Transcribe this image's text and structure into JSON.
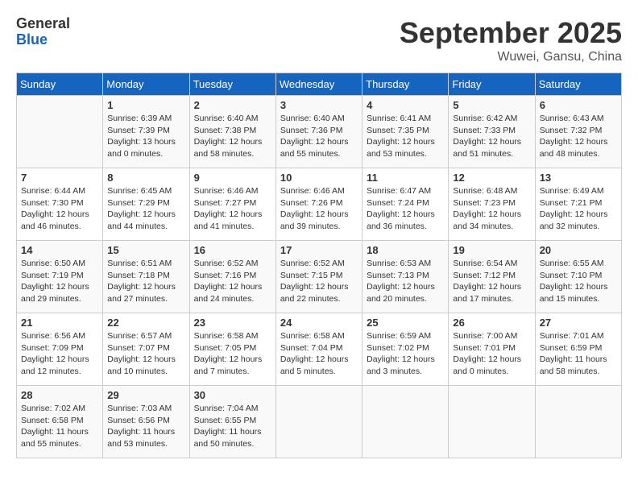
{
  "header": {
    "logo_general": "General",
    "logo_blue": "Blue",
    "month_title": "September 2025",
    "subtitle": "Wuwei, Gansu, China"
  },
  "days_of_week": [
    "Sunday",
    "Monday",
    "Tuesday",
    "Wednesday",
    "Thursday",
    "Friday",
    "Saturday"
  ],
  "weeks": [
    {
      "days": [
        {
          "number": "",
          "info": ""
        },
        {
          "number": "1",
          "info": "Sunrise: 6:39 AM\nSunset: 7:39 PM\nDaylight: 13 hours\nand 0 minutes."
        },
        {
          "number": "2",
          "info": "Sunrise: 6:40 AM\nSunset: 7:38 PM\nDaylight: 12 hours\nand 58 minutes."
        },
        {
          "number": "3",
          "info": "Sunrise: 6:40 AM\nSunset: 7:36 PM\nDaylight: 12 hours\nand 55 minutes."
        },
        {
          "number": "4",
          "info": "Sunrise: 6:41 AM\nSunset: 7:35 PM\nDaylight: 12 hours\nand 53 minutes."
        },
        {
          "number": "5",
          "info": "Sunrise: 6:42 AM\nSunset: 7:33 PM\nDaylight: 12 hours\nand 51 minutes."
        },
        {
          "number": "6",
          "info": "Sunrise: 6:43 AM\nSunset: 7:32 PM\nDaylight: 12 hours\nand 48 minutes."
        }
      ]
    },
    {
      "days": [
        {
          "number": "7",
          "info": "Sunrise: 6:44 AM\nSunset: 7:30 PM\nDaylight: 12 hours\nand 46 minutes."
        },
        {
          "number": "8",
          "info": "Sunrise: 6:45 AM\nSunset: 7:29 PM\nDaylight: 12 hours\nand 44 minutes."
        },
        {
          "number": "9",
          "info": "Sunrise: 6:46 AM\nSunset: 7:27 PM\nDaylight: 12 hours\nand 41 minutes."
        },
        {
          "number": "10",
          "info": "Sunrise: 6:46 AM\nSunset: 7:26 PM\nDaylight: 12 hours\nand 39 minutes."
        },
        {
          "number": "11",
          "info": "Sunrise: 6:47 AM\nSunset: 7:24 PM\nDaylight: 12 hours\nand 36 minutes."
        },
        {
          "number": "12",
          "info": "Sunrise: 6:48 AM\nSunset: 7:23 PM\nDaylight: 12 hours\nand 34 minutes."
        },
        {
          "number": "13",
          "info": "Sunrise: 6:49 AM\nSunset: 7:21 PM\nDaylight: 12 hours\nand 32 minutes."
        }
      ]
    },
    {
      "days": [
        {
          "number": "14",
          "info": "Sunrise: 6:50 AM\nSunset: 7:19 PM\nDaylight: 12 hours\nand 29 minutes."
        },
        {
          "number": "15",
          "info": "Sunrise: 6:51 AM\nSunset: 7:18 PM\nDaylight: 12 hours\nand 27 minutes."
        },
        {
          "number": "16",
          "info": "Sunrise: 6:52 AM\nSunset: 7:16 PM\nDaylight: 12 hours\nand 24 minutes."
        },
        {
          "number": "17",
          "info": "Sunrise: 6:52 AM\nSunset: 7:15 PM\nDaylight: 12 hours\nand 22 minutes."
        },
        {
          "number": "18",
          "info": "Sunrise: 6:53 AM\nSunset: 7:13 PM\nDaylight: 12 hours\nand 20 minutes."
        },
        {
          "number": "19",
          "info": "Sunrise: 6:54 AM\nSunset: 7:12 PM\nDaylight: 12 hours\nand 17 minutes."
        },
        {
          "number": "20",
          "info": "Sunrise: 6:55 AM\nSunset: 7:10 PM\nDaylight: 12 hours\nand 15 minutes."
        }
      ]
    },
    {
      "days": [
        {
          "number": "21",
          "info": "Sunrise: 6:56 AM\nSunset: 7:09 PM\nDaylight: 12 hours\nand 12 minutes."
        },
        {
          "number": "22",
          "info": "Sunrise: 6:57 AM\nSunset: 7:07 PM\nDaylight: 12 hours\nand 10 minutes."
        },
        {
          "number": "23",
          "info": "Sunrise: 6:58 AM\nSunset: 7:05 PM\nDaylight: 12 hours\nand 7 minutes."
        },
        {
          "number": "24",
          "info": "Sunrise: 6:58 AM\nSunset: 7:04 PM\nDaylight: 12 hours\nand 5 minutes."
        },
        {
          "number": "25",
          "info": "Sunrise: 6:59 AM\nSunset: 7:02 PM\nDaylight: 12 hours\nand 3 minutes."
        },
        {
          "number": "26",
          "info": "Sunrise: 7:00 AM\nSunset: 7:01 PM\nDaylight: 12 hours\nand 0 minutes."
        },
        {
          "number": "27",
          "info": "Sunrise: 7:01 AM\nSunset: 6:59 PM\nDaylight: 11 hours\nand 58 minutes."
        }
      ]
    },
    {
      "days": [
        {
          "number": "28",
          "info": "Sunrise: 7:02 AM\nSunset: 6:58 PM\nDaylight: 11 hours\nand 55 minutes."
        },
        {
          "number": "29",
          "info": "Sunrise: 7:03 AM\nSunset: 6:56 PM\nDaylight: 11 hours\nand 53 minutes."
        },
        {
          "number": "30",
          "info": "Sunrise: 7:04 AM\nSunset: 6:55 PM\nDaylight: 11 hours\nand 50 minutes."
        },
        {
          "number": "",
          "info": ""
        },
        {
          "number": "",
          "info": ""
        },
        {
          "number": "",
          "info": ""
        },
        {
          "number": "",
          "info": ""
        }
      ]
    }
  ]
}
